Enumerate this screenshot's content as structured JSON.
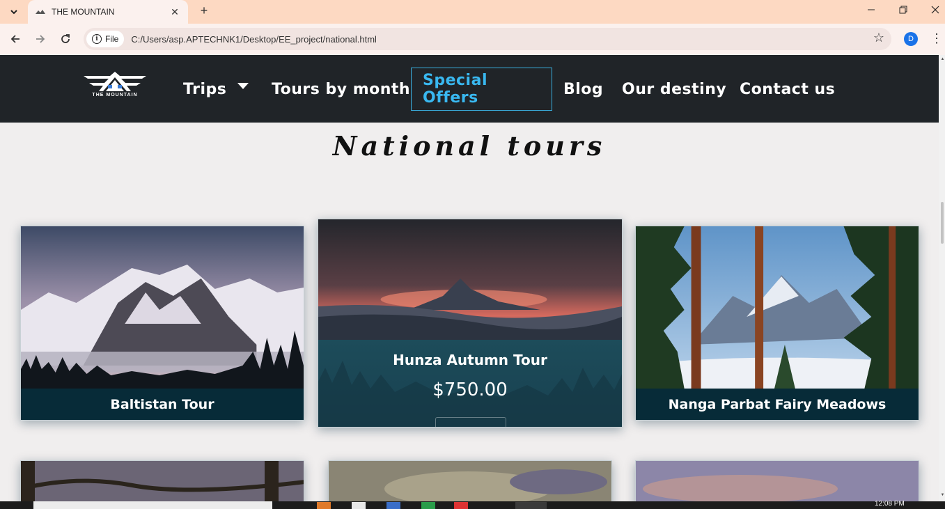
{
  "browser": {
    "tab_title": "THE MOUNTAIN",
    "site_chip": "File",
    "url": "C:/Users/asp.APTECHNK1/Desktop/EE_project/national.html",
    "profile_initial": "D"
  },
  "site": {
    "logo_text": "THE MOUNTAIN",
    "nav": {
      "trips": "Trips",
      "tours_by_month": "Tours by month",
      "special_offers": "Special Offers",
      "blog": "Blog",
      "our_destiny": "Our destiny",
      "contact_us": "Contact us"
    },
    "section_title": "National tours",
    "cards": [
      {
        "title": "Baltistan Tour"
      },
      {
        "title": "Hunza Autumn Tour",
        "price": "$750.00"
      },
      {
        "title": "Nanga Parbat Fairy Meadows"
      }
    ]
  },
  "taskbar": {
    "time": "12:08 PM"
  },
  "colors": {
    "navbar_bg": "#202428",
    "accent": "#39b8f0",
    "caption_bg": "#072b38",
    "tab_strip": "#fdd9c2"
  }
}
